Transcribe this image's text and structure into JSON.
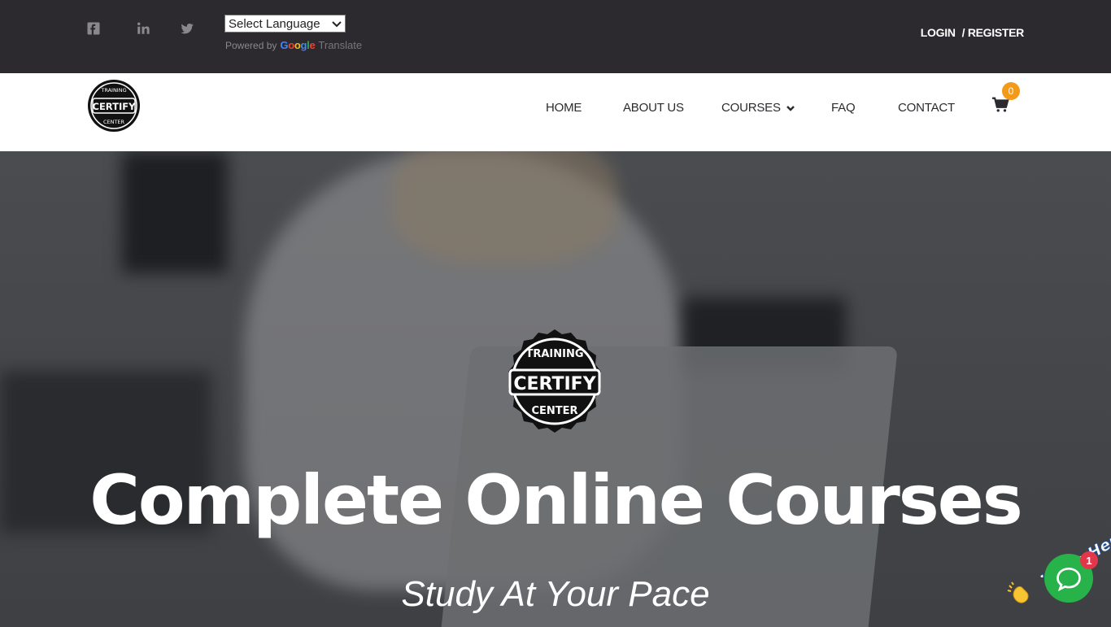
{
  "topbar": {
    "social": [
      "facebook-icon",
      "linkedin-icon",
      "twitter-icon"
    ],
    "language_select": {
      "value": "Select Language"
    },
    "powered_by": "Powered by",
    "google": [
      "G",
      "o",
      "o",
      "g",
      "l",
      "e"
    ],
    "translate": "Translate",
    "login": "LOGIN",
    "register": "/ REGISTER"
  },
  "brand": {
    "logo_top": "TRAINING",
    "logo_main": "CERTIFY",
    "logo_bottom": "CENTER"
  },
  "nav": {
    "items": [
      "HOME",
      "ABOUT US",
      "COURSES",
      "FAQ",
      "CONTACT"
    ],
    "cart_count": "0"
  },
  "hero": {
    "title": "Complete Online Courses",
    "subtitle": "Study At Your Pace"
  },
  "chat": {
    "label": "We Are Here!",
    "badge": "1"
  },
  "colors": {
    "topbar": "#2c2a2e",
    "accent_orange": "#f39a18",
    "chat_green": "#27b24a",
    "badge_red": "#e2374a"
  }
}
